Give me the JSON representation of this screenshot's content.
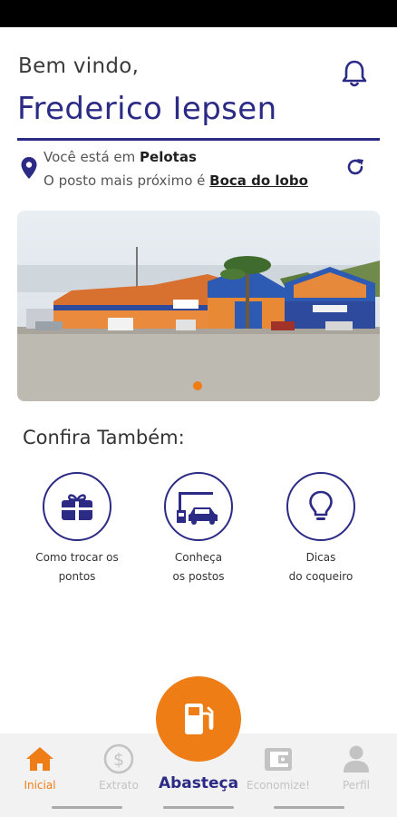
{
  "header": {
    "greeting": "Bem vindo,",
    "user_name": "Frederico Iepsen"
  },
  "location": {
    "prefix": "Você está em",
    "city": "Pelotas",
    "nearest_prefix": "O posto mais próximo é",
    "nearest_station": "Boca do lobo"
  },
  "banner": {
    "slide_count": 1,
    "active_slide": 1
  },
  "section": {
    "title": "Confira Também:"
  },
  "shortcuts": [
    {
      "line1": "Como trocar os",
      "line2": "pontos",
      "icon": "gift-card-icon"
    },
    {
      "line1": "Conheça",
      "line2": "os postos",
      "icon": "gas-station-car-icon"
    },
    {
      "line1": "Dicas",
      "line2": "do coqueiro",
      "icon": "lightbulb-icon"
    }
  ],
  "bottom_nav": {
    "items": [
      {
        "label": "Inicial",
        "icon": "home-icon",
        "active": true
      },
      {
        "label": "Extrato",
        "icon": "dollar-icon",
        "active": false
      },
      {
        "label": "Economize!",
        "icon": "wallet-icon",
        "active": false
      },
      {
        "label": "Perfil",
        "icon": "person-icon",
        "active": false
      }
    ],
    "fab_label": "Abasteça",
    "fab_icon": "fuel-pump-icon"
  },
  "colors": {
    "primary": "#2b2a85",
    "accent": "#ee7d16",
    "inactive": "#c3c3c3"
  }
}
